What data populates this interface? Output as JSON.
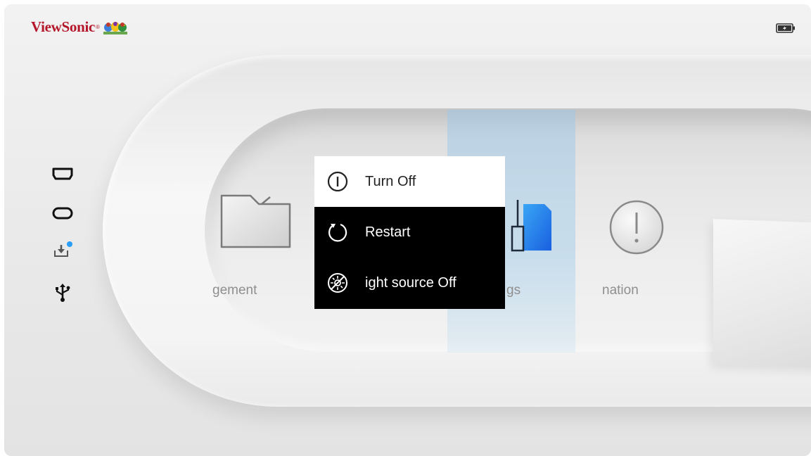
{
  "brand": {
    "name": "ViewSonic",
    "registered": "®",
    "logo_icon": "viewsonic-birds-logo"
  },
  "status": {
    "battery_icon": "battery-charging-icon"
  },
  "sources": [
    {
      "icon": "hdmi-port-icon"
    },
    {
      "icon": "usb-c-port-icon"
    },
    {
      "icon": "download-tray-icon",
      "indicator_color": "#2a9df4"
    },
    {
      "icon": "usb-icon"
    }
  ],
  "apps": [
    {
      "label": "gement",
      "icon": "folder-icon"
    },
    {
      "label": "gs",
      "icon": "settings-icon"
    },
    {
      "label": "nation",
      "icon": "info-alert-icon"
    }
  ],
  "power_menu": {
    "items": [
      {
        "label": "Turn Off",
        "icon": "power-icon",
        "selected": true
      },
      {
        "label": "Restart",
        "icon": "restart-icon",
        "selected": false
      },
      {
        "label": "ight source Off",
        "icon": "light-source-off-icon",
        "selected": false
      }
    ]
  },
  "colors": {
    "brand_red": "#b4172a",
    "accent_blue": "#2a9df4",
    "menu_bg": "#000000",
    "menu_selected_bg": "#ffffff"
  }
}
